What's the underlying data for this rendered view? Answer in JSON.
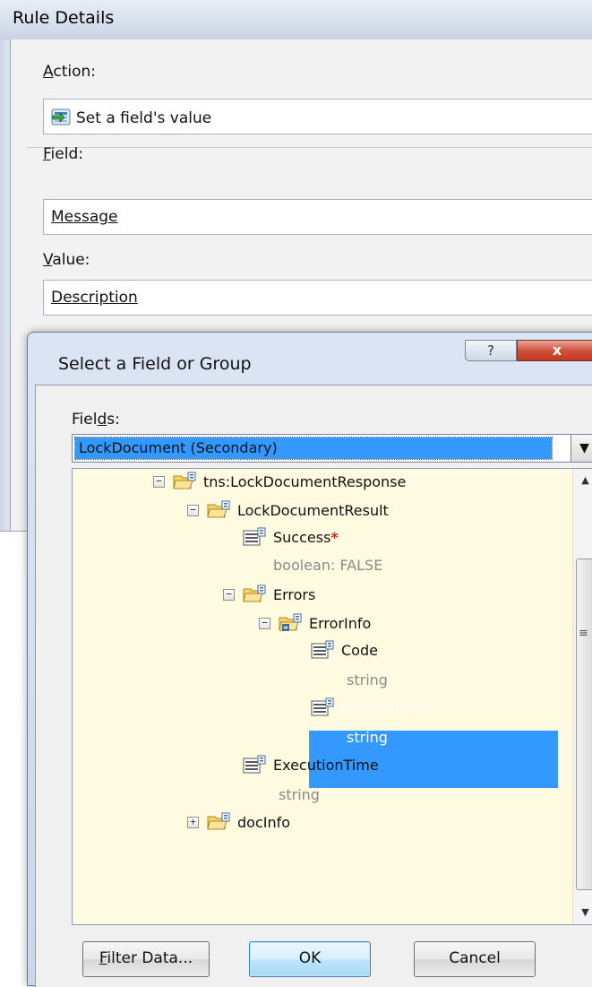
{
  "rule_window": {
    "title": "Rule Details",
    "action_label": "Action:",
    "action_label_key": "A",
    "action_label_rest": "ction:",
    "action_value": "Set a field's value",
    "field_label_key": "F",
    "field_label_rest": "ield:",
    "field_value": "Message",
    "value_label_key": "V",
    "value_label_rest": "alue:",
    "value_value": "Description"
  },
  "dialog": {
    "title": "Select a Field or Group",
    "help_label": "?",
    "close_label": "x",
    "fields_label_pre": "Fiel",
    "fields_label_key": "d",
    "fields_label_post": "s:",
    "data_source": "LockDocument (Secondary)",
    "tree": {
      "root": {
        "label": "tns:LockDocumentResponse",
        "toggle": "−"
      },
      "result": {
        "label": "LockDocumentResult",
        "toggle": "−"
      },
      "success": {
        "label": "Success",
        "required_mark": "*",
        "meta": "boolean: FALSE"
      },
      "errors": {
        "label": "Errors",
        "toggle": "−"
      },
      "errorinfo": {
        "label": "ErrorInfo",
        "toggle": "−"
      },
      "code": {
        "label": "Code",
        "meta": "string"
      },
      "description": {
        "label": "Description",
        "meta": "string",
        "selected": true
      },
      "executiontime": {
        "label": "ExecutionTime",
        "meta": "string"
      },
      "docinfo": {
        "label": "docInfo",
        "toggle": "+"
      }
    },
    "buttons": {
      "filter_key": "F",
      "filter_rest": "ilter Data...",
      "ok": "OK",
      "cancel": "Cancel"
    }
  },
  "colors": {
    "selection": "#3399ff",
    "tree_background": "#fffbe0",
    "close_button": "#c0391f"
  }
}
